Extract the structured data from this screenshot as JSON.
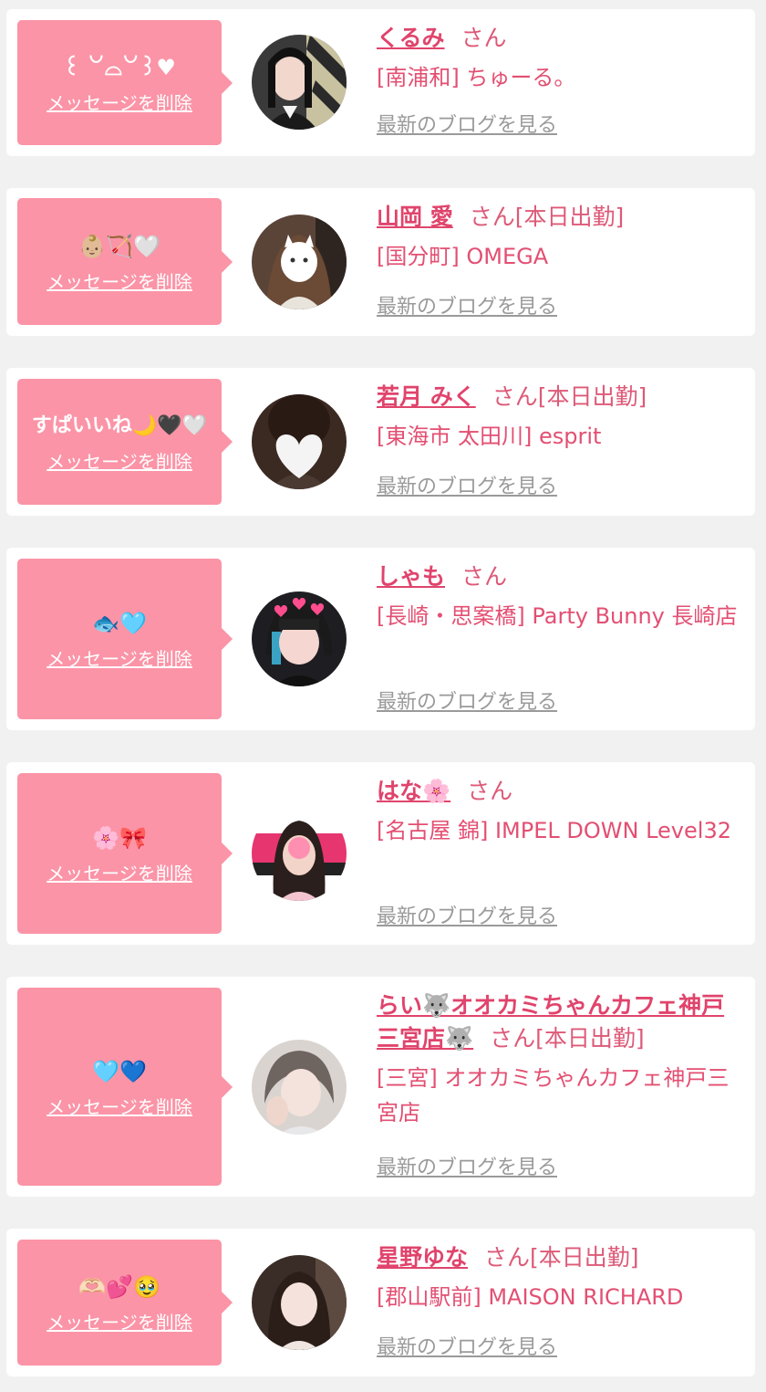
{
  "delete_label": "メッセージを削除",
  "blog_label": "最新のブログを見る",
  "san_label": "さん",
  "colors": {
    "bubble": "#fb94a7",
    "name": "#e0446c",
    "text": "#e34f72",
    "link_gray": "#9a9a9a",
    "background": "#f1f1f1"
  },
  "items": [
    {
      "message": "꒰ ꒡⌓꒡꒱♥",
      "name": "くるみ",
      "status": "",
      "shop": "[南浦和] ちゅーる。"
    },
    {
      "message": "👶🏼🏹🤍",
      "name": "山岡 愛",
      "status": "[本日出勤]",
      "shop": "[国分町] OMEGA"
    },
    {
      "message": "すぱいいね🌙🖤🤍",
      "name": "若月 みく",
      "status": "[本日出勤]",
      "shop": "[東海市 太田川] esprit"
    },
    {
      "message": "🐟🩵",
      "name": "しゃも",
      "status": "",
      "shop": "[長崎・思案橋] Party Bunny 長崎店"
    },
    {
      "message": "🌸🎀",
      "name": "はな🌸",
      "status": "",
      "shop": "[名古屋 錦] IMPEL DOWN Level32"
    },
    {
      "message": "🩵💙",
      "name": "らい🐺オオカミちゃんカフェ神戸三宮店🐺",
      "status": "[本日出勤]",
      "shop": "[三宮] オオカミちゃんカフェ神戸三宮店"
    },
    {
      "message": "🫶🏻💕🥹",
      "name": "星野ゆな",
      "status": "[本日出勤]",
      "shop": "[郡山駅前] MAISON RICHARD"
    }
  ]
}
